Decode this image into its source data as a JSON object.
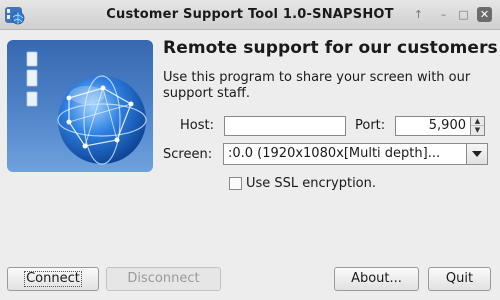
{
  "window": {
    "title": "Customer Support Tool 1.0-SNAPSHOT",
    "controls": [
      "up",
      "minimize",
      "maximize",
      "close"
    ]
  },
  "colors": {
    "banner_top": "#3768b0",
    "banner_bottom": "#6ea1dd",
    "window_bg": "#ededed",
    "close_button": "#6b6b6b"
  },
  "main": {
    "heading": "Remote support for our customers",
    "description": "Use this program to share your screen with our support staff."
  },
  "form": {
    "host_label": "Host:",
    "host_value": "",
    "port_label": "Port:",
    "port_value": "5,900",
    "screen_label": "Screen:",
    "screen_value": ":0.0 (1920x1080x[Multi depth]...",
    "ssl_label": "Use SSL encryption.",
    "ssl_checked": false
  },
  "buttons": {
    "connect": "Connect",
    "disconnect": "Disconnect",
    "about": "About...",
    "quit": "Quit"
  }
}
